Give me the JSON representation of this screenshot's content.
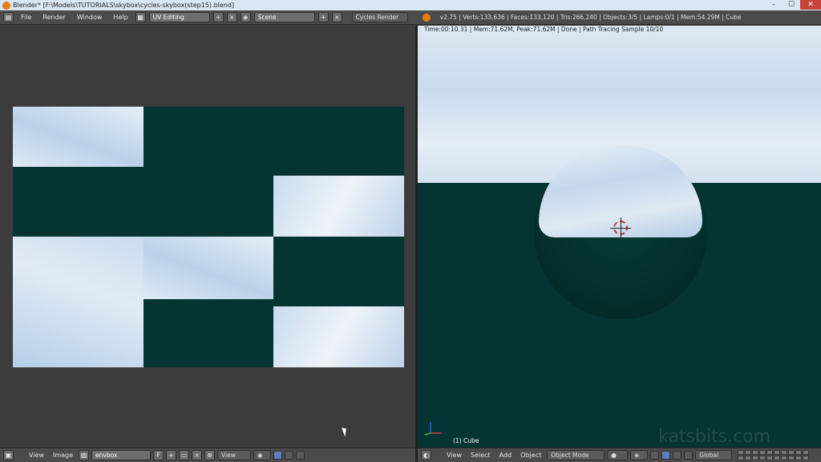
{
  "window": {
    "title": "Blender* [F:\\Models\\TUTORIALS\\skybox\\cycles-skybox(step15).blend]",
    "controls": [
      "–",
      "☐",
      "✕"
    ]
  },
  "info_header": {
    "menus": [
      "File",
      "Render",
      "Window",
      "Help"
    ],
    "screen_layout": "UV Editing",
    "scene": "Scene",
    "render_engine": "Cycles Render",
    "stats": "v2.75 | Verts:133,636 | Faces:133,120 | Tris:266,240 | Objects:3/5 | Lamps:0/1 | Mem:54.29M | Cube"
  },
  "viewport": {
    "render_status": "Time:00:10.31 | Mem:71.62M, Peak:71.62M | Done | Path Tracing Sample 10/10",
    "object_label": "(1) Cube",
    "watermark": "katsbits.com"
  },
  "uv_footer": {
    "menus": [
      "View",
      "Image"
    ],
    "image_name": "envbox",
    "fake_user": "F",
    "view_mode": "View"
  },
  "viewport_footer": {
    "menus": [
      "View",
      "Select",
      "Add",
      "Object"
    ],
    "mode": "Object Mode",
    "orientation": "Global"
  }
}
